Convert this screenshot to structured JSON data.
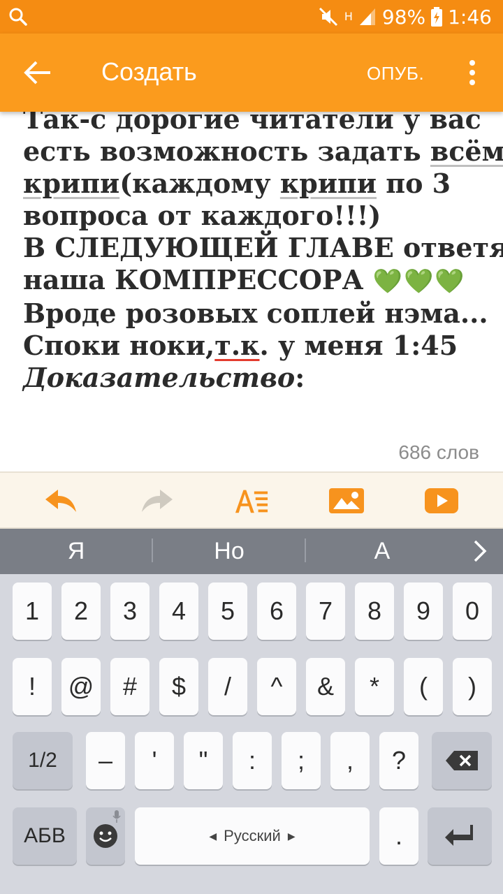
{
  "status_bar": {
    "battery": "98%",
    "time": "1:46",
    "network": "H"
  },
  "app_bar": {
    "title": "Создать",
    "publish_label": "ОПУБ."
  },
  "editor": {
    "lines": [
      "Так-с дорогие читатели у вас",
      "есть возможность задать всём",
      "крипи(каждому крипи по 3",
      "вопроса от каждого!!!)",
      "В СЛЕДУЮЩЕЙ ГЛАВЕ ответят",
      "наша КОМПРЕССОРА",
      "Вроде розовых соплей нэма...",
      "Споки ноки,т.к. у меня 1:45",
      "Доказательство"
    ],
    "line2_a": "есть возможность задать ",
    "line2_b": "всём",
    "line3_a": "крипи",
    "line3_b": "(каждому ",
    "line3_c": "крипи",
    "line3_d": " по 3",
    "line6_a": "наша КОМПРЕССОРА ",
    "hearts": "💚💚💚",
    "line8_a": "Споки ноки,",
    "line8_b": "т.к",
    "line8_c": ". у меня 1:45",
    "line9_a": "Доказательство",
    "line9_b": ":",
    "word_count": "686 слов"
  },
  "toolbar": {
    "icons": [
      "undo-icon",
      "redo-icon",
      "text-format-icon",
      "image-icon",
      "video-icon"
    ]
  },
  "suggestions": [
    "Я",
    "Но",
    "А"
  ],
  "keyboard": {
    "row1": [
      "1",
      "2",
      "3",
      "4",
      "5",
      "6",
      "7",
      "8",
      "9",
      "0"
    ],
    "row2": [
      "!",
      "@",
      "#",
      "$",
      "/",
      "^",
      "&",
      "*",
      "(",
      ")"
    ],
    "row3_toggle": "1/2",
    "row3": [
      "–",
      "'",
      "\"",
      ":",
      ";",
      ",",
      "?"
    ],
    "lang_switch": "АБВ",
    "space_label": "Русский",
    "period": "."
  },
  "colors": {
    "status_bar": "#f58c12",
    "app_bar": "#fb9b1d",
    "accent": "#f7931e",
    "toolbar_bg": "#fbf5ea",
    "suggestion_bg": "#7a7e86",
    "keyboard_bg": "#d5d7de"
  }
}
